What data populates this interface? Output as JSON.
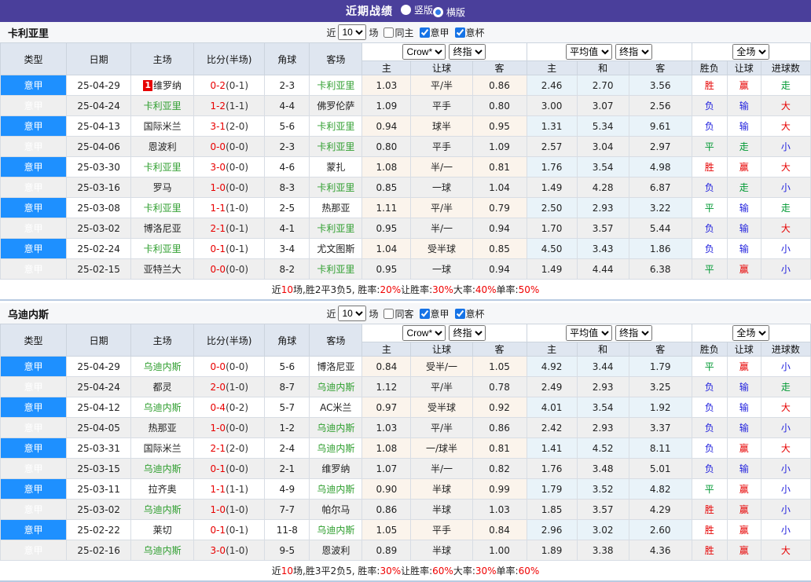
{
  "header": {
    "title": "近期战绩",
    "radios": [
      {
        "label": "竖版",
        "selected": false
      },
      {
        "label": "横版",
        "selected": true
      }
    ],
    "bar_color": "#4a3f9b"
  },
  "colors": {
    "league_cell": "#1e90ff",
    "focal_team": "#2e9e2e",
    "win_red": "#e60000",
    "lose_blue": "#2222dd",
    "draw_green": "#009933",
    "ah_column_tint": "#fbf4ec",
    "eu_column_tint": "#e9f3f9"
  },
  "tables": [
    {
      "team": "卡利亚里",
      "controls": {
        "near": "近",
        "count": "10",
        "games": "场",
        "checkboxes": [
          {
            "label": "同主",
            "checked": false
          },
          {
            "label": "意甲",
            "checked": true
          },
          {
            "label": "意杯",
            "checked": true
          }
        ]
      },
      "main_headers": [
        "类型",
        "日期",
        "主场",
        "比分(半场)",
        "角球",
        "客场"
      ],
      "selects": {
        "group1": [
          "Crow*",
          "终指"
        ],
        "group2": [
          "平均值",
          "终指"
        ],
        "group3": [
          "全场"
        ]
      },
      "sub_headers": [
        "主",
        "让球",
        "客",
        "主",
        "和",
        "客",
        "胜负",
        "让球",
        "进球数"
      ],
      "rows": [
        {
          "league": "意甲",
          "date": "25-04-29",
          "home": "维罗纳",
          "home_focal": false,
          "home_badge": "1",
          "score": "0-2",
          "half": "(0-1)",
          "corner": "2-3",
          "away": "卡利亚里",
          "away_focal": true,
          "ah": [
            "1.03",
            "平/半",
            "0.86"
          ],
          "eu": [
            "2.46",
            "2.70",
            "3.56"
          ],
          "res": [
            [
              "胜",
              "r"
            ],
            [
              "赢",
              "r"
            ],
            [
              "走",
              "g"
            ]
          ]
        },
        {
          "league": "意甲",
          "date": "25-04-24",
          "home": "卡利亚里",
          "home_focal": true,
          "score": "1-2",
          "half": "(1-1)",
          "corner": "4-4",
          "away": "佛罗伦萨",
          "away_focal": false,
          "ah": [
            "1.09",
            "平手",
            "0.80"
          ],
          "eu": [
            "3.00",
            "3.07",
            "2.56"
          ],
          "res": [
            [
              "负",
              "b"
            ],
            [
              "输",
              "b"
            ],
            [
              "大",
              "r"
            ]
          ]
        },
        {
          "league": "意甲",
          "date": "25-04-13",
          "home": "国际米兰",
          "home_focal": false,
          "score": "3-1",
          "half": "(2-0)",
          "corner": "5-6",
          "away": "卡利亚里",
          "away_focal": true,
          "ah": [
            "0.94",
            "球半",
            "0.95"
          ],
          "eu": [
            "1.31",
            "5.34",
            "9.61"
          ],
          "res": [
            [
              "负",
              "b"
            ],
            [
              "输",
              "b"
            ],
            [
              "大",
              "r"
            ]
          ]
        },
        {
          "league": "意甲",
          "date": "25-04-06",
          "home": "恩波利",
          "home_focal": false,
          "score": "0-0",
          "half": "(0-0)",
          "corner": "2-3",
          "away": "卡利亚里",
          "away_focal": true,
          "ah": [
            "0.80",
            "平手",
            "1.09"
          ],
          "eu": [
            "2.57",
            "3.04",
            "2.97"
          ],
          "res": [
            [
              "平",
              "g"
            ],
            [
              "走",
              "g"
            ],
            [
              "小",
              "b"
            ]
          ]
        },
        {
          "league": "意甲",
          "date": "25-03-30",
          "home": "卡利亚里",
          "home_focal": true,
          "score": "3-0",
          "half": "(0-0)",
          "corner": "4-6",
          "away": "蒙扎",
          "away_focal": false,
          "ah": [
            "1.08",
            "半/一",
            "0.81"
          ],
          "eu": [
            "1.76",
            "3.54",
            "4.98"
          ],
          "res": [
            [
              "胜",
              "r"
            ],
            [
              "赢",
              "r"
            ],
            [
              "大",
              "r"
            ]
          ]
        },
        {
          "league": "意甲",
          "date": "25-03-16",
          "home": "罗马",
          "home_focal": false,
          "score": "1-0",
          "half": "(0-0)",
          "corner": "8-3",
          "away": "卡利亚里",
          "away_focal": true,
          "ah": [
            "0.85",
            "一球",
            "1.04"
          ],
          "eu": [
            "1.49",
            "4.28",
            "6.87"
          ],
          "res": [
            [
              "负",
              "b"
            ],
            [
              "走",
              "g"
            ],
            [
              "小",
              "b"
            ]
          ]
        },
        {
          "league": "意甲",
          "date": "25-03-08",
          "home": "卡利亚里",
          "home_focal": true,
          "score": "1-1",
          "half": "(1-0)",
          "corner": "2-5",
          "away": "热那亚",
          "away_focal": false,
          "ah": [
            "1.11",
            "平/半",
            "0.79"
          ],
          "eu": [
            "2.50",
            "2.93",
            "3.22"
          ],
          "res": [
            [
              "平",
              "g"
            ],
            [
              "输",
              "b"
            ],
            [
              "走",
              "g"
            ]
          ]
        },
        {
          "league": "意甲",
          "date": "25-03-02",
          "home": "博洛尼亚",
          "home_focal": false,
          "score": "2-1",
          "half": "(0-1)",
          "corner": "4-1",
          "away": "卡利亚里",
          "away_focal": true,
          "ah": [
            "0.95",
            "半/一",
            "0.94"
          ],
          "eu": [
            "1.70",
            "3.57",
            "5.44"
          ],
          "res": [
            [
              "负",
              "b"
            ],
            [
              "输",
              "b"
            ],
            [
              "大",
              "r"
            ]
          ]
        },
        {
          "league": "意甲",
          "date": "25-02-24",
          "home": "卡利亚里",
          "home_focal": true,
          "score": "0-1",
          "half": "(0-1)",
          "corner": "3-4",
          "away": "尤文图斯",
          "away_focal": false,
          "ah": [
            "1.04",
            "受半球",
            "0.85"
          ],
          "eu": [
            "4.50",
            "3.43",
            "1.86"
          ],
          "res": [
            [
              "负",
              "b"
            ],
            [
              "输",
              "b"
            ],
            [
              "小",
              "b"
            ]
          ]
        },
        {
          "league": "意甲",
          "date": "25-02-15",
          "home": "亚特兰大",
          "home_focal": false,
          "score": "0-0",
          "half": "(0-0)",
          "corner": "8-2",
          "away": "卡利亚里",
          "away_focal": true,
          "ah": [
            "0.95",
            "一球",
            "0.94"
          ],
          "eu": [
            "1.49",
            "4.44",
            "6.38"
          ],
          "res": [
            [
              "平",
              "g"
            ],
            [
              "赢",
              "r"
            ],
            [
              "小",
              "b"
            ]
          ]
        }
      ],
      "summary": [
        [
          "近",
          "k"
        ],
        [
          "10",
          "r"
        ],
        [
          "场,胜2平3负5, 胜率:",
          "k"
        ],
        [
          "20%",
          "r"
        ],
        [
          " 让胜率:",
          "k"
        ],
        [
          "30%",
          "r"
        ],
        [
          " 大率:",
          "k"
        ],
        [
          "40%",
          "r"
        ],
        [
          " 单率:",
          "k"
        ],
        [
          "50%",
          "r"
        ]
      ]
    },
    {
      "team": "乌迪内斯",
      "controls": {
        "near": "近",
        "count": "10",
        "games": "场",
        "checkboxes": [
          {
            "label": "同客",
            "checked": false
          },
          {
            "label": "意甲",
            "checked": true
          },
          {
            "label": "意杯",
            "checked": true
          }
        ]
      },
      "main_headers": [
        "类型",
        "日期",
        "主场",
        "比分(半场)",
        "角球",
        "客场"
      ],
      "selects": {
        "group1": [
          "Crow*",
          "终指"
        ],
        "group2": [
          "平均值",
          "终指"
        ],
        "group3": [
          "全场"
        ]
      },
      "sub_headers": [
        "主",
        "让球",
        "客",
        "主",
        "和",
        "客",
        "胜负",
        "让球",
        "进球数"
      ],
      "rows": [
        {
          "league": "意甲",
          "date": "25-04-29",
          "home": "乌迪内斯",
          "home_focal": true,
          "score": "0-0",
          "half": "(0-0)",
          "corner": "5-6",
          "away": "博洛尼亚",
          "away_focal": false,
          "ah": [
            "0.84",
            "受半/一",
            "1.05"
          ],
          "eu": [
            "4.92",
            "3.44",
            "1.79"
          ],
          "res": [
            [
              "平",
              "g"
            ],
            [
              "赢",
              "r"
            ],
            [
              "小",
              "b"
            ]
          ]
        },
        {
          "league": "意甲",
          "date": "25-04-24",
          "home": "都灵",
          "home_focal": false,
          "score": "2-0",
          "half": "(1-0)",
          "corner": "8-7",
          "away": "乌迪内斯",
          "away_focal": true,
          "ah": [
            "1.12",
            "平/半",
            "0.78"
          ],
          "eu": [
            "2.49",
            "2.93",
            "3.25"
          ],
          "res": [
            [
              "负",
              "b"
            ],
            [
              "输",
              "b"
            ],
            [
              "走",
              "g"
            ]
          ]
        },
        {
          "league": "意甲",
          "date": "25-04-12",
          "home": "乌迪内斯",
          "home_focal": true,
          "score": "0-4",
          "half": "(0-2)",
          "corner": "5-7",
          "away": "AC米兰",
          "away_focal": false,
          "ah": [
            "0.97",
            "受半球",
            "0.92"
          ],
          "eu": [
            "4.01",
            "3.54",
            "1.92"
          ],
          "res": [
            [
              "负",
              "b"
            ],
            [
              "输",
              "b"
            ],
            [
              "大",
              "r"
            ]
          ]
        },
        {
          "league": "意甲",
          "date": "25-04-05",
          "home": "热那亚",
          "home_focal": false,
          "score": "1-0",
          "half": "(0-0)",
          "corner": "1-2",
          "away": "乌迪内斯",
          "away_focal": true,
          "ah": [
            "1.03",
            "平/半",
            "0.86"
          ],
          "eu": [
            "2.42",
            "2.93",
            "3.37"
          ],
          "res": [
            [
              "负",
              "b"
            ],
            [
              "输",
              "b"
            ],
            [
              "小",
              "b"
            ]
          ]
        },
        {
          "league": "意甲",
          "date": "25-03-31",
          "home": "国际米兰",
          "home_focal": false,
          "score": "2-1",
          "half": "(2-0)",
          "corner": "2-4",
          "away": "乌迪内斯",
          "away_focal": true,
          "ah": [
            "1.08",
            "一/球半",
            "0.81"
          ],
          "eu": [
            "1.41",
            "4.52",
            "8.11"
          ],
          "res": [
            [
              "负",
              "b"
            ],
            [
              "赢",
              "r"
            ],
            [
              "大",
              "r"
            ]
          ]
        },
        {
          "league": "意甲",
          "date": "25-03-15",
          "home": "乌迪内斯",
          "home_focal": true,
          "score": "0-1",
          "half": "(0-0)",
          "corner": "2-1",
          "away": "维罗纳",
          "away_focal": false,
          "ah": [
            "1.07",
            "半/一",
            "0.82"
          ],
          "eu": [
            "1.76",
            "3.48",
            "5.01"
          ],
          "res": [
            [
              "负",
              "b"
            ],
            [
              "输",
              "b"
            ],
            [
              "小",
              "b"
            ]
          ]
        },
        {
          "league": "意甲",
          "date": "25-03-11",
          "home": "拉齐奥",
          "home_focal": false,
          "score": "1-1",
          "half": "(1-1)",
          "corner": "4-9",
          "away": "乌迪内斯",
          "away_focal": true,
          "ah": [
            "0.90",
            "半球",
            "0.99"
          ],
          "eu": [
            "1.79",
            "3.52",
            "4.82"
          ],
          "res": [
            [
              "平",
              "g"
            ],
            [
              "赢",
              "r"
            ],
            [
              "小",
              "b"
            ]
          ]
        },
        {
          "league": "意甲",
          "date": "25-03-02",
          "home": "乌迪内斯",
          "home_focal": true,
          "score": "1-0",
          "half": "(1-0)",
          "corner": "7-7",
          "away": "帕尔马",
          "away_focal": false,
          "ah": [
            "0.86",
            "半球",
            "1.03"
          ],
          "eu": [
            "1.85",
            "3.57",
            "4.29"
          ],
          "res": [
            [
              "胜",
              "r"
            ],
            [
              "赢",
              "r"
            ],
            [
              "小",
              "b"
            ]
          ]
        },
        {
          "league": "意甲",
          "date": "25-02-22",
          "home": "莱切",
          "home_focal": false,
          "score": "0-1",
          "half": "(0-1)",
          "corner": "11-8",
          "away": "乌迪内斯",
          "away_focal": true,
          "ah": [
            "1.05",
            "平手",
            "0.84"
          ],
          "eu": [
            "2.96",
            "3.02",
            "2.60"
          ],
          "res": [
            [
              "胜",
              "r"
            ],
            [
              "赢",
              "r"
            ],
            [
              "小",
              "b"
            ]
          ]
        },
        {
          "league": "意甲",
          "date": "25-02-16",
          "home": "乌迪内斯",
          "home_focal": true,
          "score": "3-0",
          "half": "(1-0)",
          "corner": "9-5",
          "away": "恩波利",
          "away_focal": false,
          "ah": [
            "0.89",
            "半球",
            "1.00"
          ],
          "eu": [
            "1.89",
            "3.38",
            "4.36"
          ],
          "res": [
            [
              "胜",
              "r"
            ],
            [
              "赢",
              "r"
            ],
            [
              "大",
              "r"
            ]
          ]
        }
      ],
      "summary": [
        [
          "近",
          "k"
        ],
        [
          "10",
          "r"
        ],
        [
          "场,胜3平2负5, 胜率:",
          "k"
        ],
        [
          "30%",
          "r"
        ],
        [
          " 让胜率:",
          "k"
        ],
        [
          "60%",
          "r"
        ],
        [
          " 大率:",
          "k"
        ],
        [
          "30%",
          "r"
        ],
        [
          " 单率:",
          "k"
        ],
        [
          "60%",
          "r"
        ]
      ]
    }
  ]
}
